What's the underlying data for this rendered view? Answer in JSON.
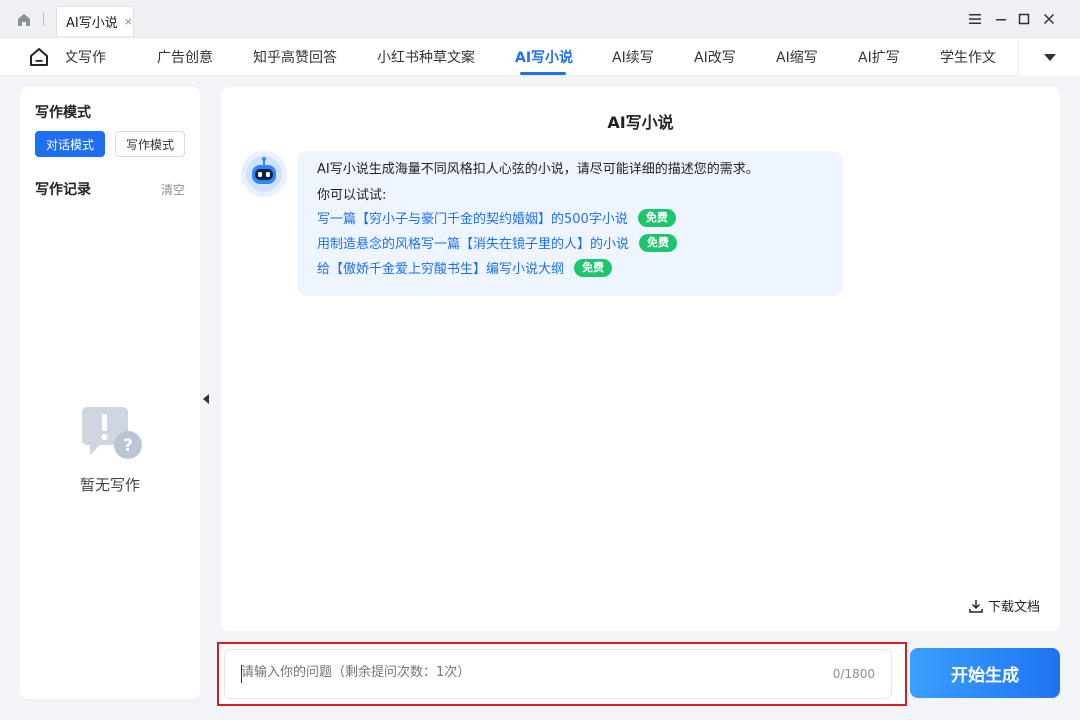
{
  "window": {
    "tab_title": "AI写小说",
    "tab_close": "×"
  },
  "nav": {
    "items": [
      "论文写作",
      "广告创意",
      "知乎高赞回答",
      "小红书种草文案",
      "AI写小说",
      "AI续写",
      "AI改写",
      "AI缩写",
      "AI扩写",
      "学生作文"
    ],
    "active_index": 4
  },
  "sidebar": {
    "mode_title": "写作模式",
    "mode_active": "对话模式",
    "mode_inactive": "写作模式",
    "record_title": "写作记录",
    "clear_label": "清空",
    "empty_text": "暂无写作"
  },
  "main": {
    "title": "AI写小说",
    "intro": "AI写小说生成海量不同风格扣人心弦的小说，请尽可能详细的描述您的需求。",
    "try_label": "你可以试试:",
    "suggestions": [
      {
        "text": "写一篇【穷小子与豪门千金的契约婚姻】的500字小说",
        "badge": "免费"
      },
      {
        "text": "用制造悬念的风格写一篇【消失在镜子里的人】的小说",
        "badge": "免费"
      },
      {
        "text": "给【傲娇千金爱上穷酸书生】编写小说大纲",
        "badge": "免费"
      }
    ],
    "download_label": "下载文档"
  },
  "input": {
    "placeholder": "请输入你的问题（剩余提问次数：1次）",
    "counter": "0/1800"
  },
  "generate_label": "开始生成",
  "colors": {
    "accent": "#1f6ff2",
    "badge": "#1fc46e",
    "highlight_border": "#d71d24"
  }
}
